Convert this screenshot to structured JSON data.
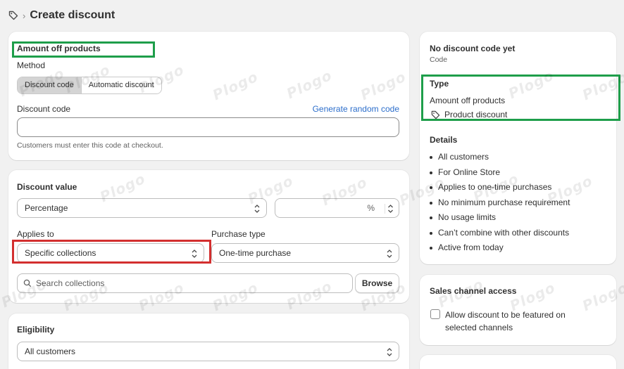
{
  "header": {
    "title": "Create discount",
    "icon": "tag-icon"
  },
  "method_card": {
    "heading": "Amount off products",
    "method_label": "Method",
    "segments": [
      "Discount code",
      "Automatic discount"
    ],
    "code_label": "Discount code",
    "generate_link": "Generate random code",
    "code_value": "",
    "helper": "Customers must enter this code at checkout."
  },
  "value_card": {
    "heading": "Discount value",
    "value_type": "Percentage",
    "percent_value": "",
    "percent_suffix": "%",
    "applies_label": "Applies to",
    "applies_value": "Specific collections",
    "purchase_label": "Purchase type",
    "purchase_value": "One-time purchase",
    "search_placeholder": "Search collections",
    "browse_label": "Browse"
  },
  "eligibility_card": {
    "heading": "Eligibility",
    "value": "All customers"
  },
  "summary_card": {
    "code_title": "No discount code yet",
    "code_sub": "Code",
    "type_heading": "Type",
    "type_value": "Amount off products",
    "type_badge": "Product discount",
    "details_heading": "Details",
    "details": [
      "All customers",
      "For Online Store",
      "Applies to one-time purchases",
      "No minimum purchase requirement",
      "No usage limits",
      "Can’t combine with other discounts",
      "Active from today"
    ]
  },
  "sales_card": {
    "heading": "Sales channel access",
    "checkbox_label_1": "Allow discount to be featured on",
    "checkbox_label_2": "selected channels"
  },
  "highlight_colors": {
    "green": "#1e9e4a",
    "red": "#d32f2f"
  },
  "watermark": "Plogo"
}
